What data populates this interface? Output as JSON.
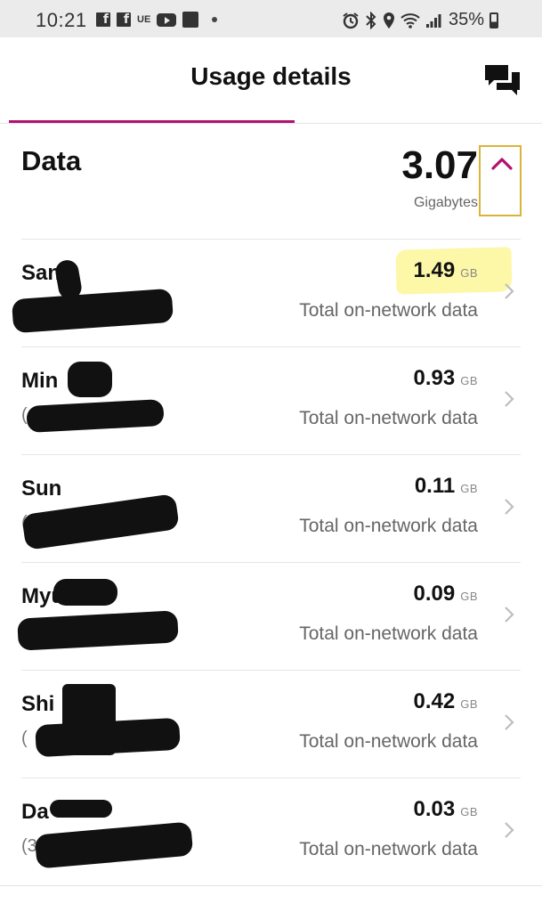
{
  "status_bar": {
    "time": "10:21",
    "ue_label": "UE",
    "battery": "35%",
    "icons": [
      "facebook-icon",
      "facebook-icon",
      "ue-icon",
      "youtube-icon",
      "bible-icon",
      "notification-dot-icon",
      "alarm-icon",
      "bluetooth-icon",
      "location-icon",
      "wifi-icon",
      "signal-icon",
      "battery-icon"
    ]
  },
  "header": {
    "title": "Usage details",
    "chat_icon": "chat-icon",
    "accent_color": "#b2116f"
  },
  "data_summary": {
    "heading": "Data",
    "total": "3.07",
    "unit": "Gigabytes",
    "toggle_icon": "chevron-up-icon"
  },
  "lines": [
    {
      "name": "San",
      "sub": "(",
      "amount": "1.49",
      "unit": "GB",
      "description": "Total on-network data"
    },
    {
      "name": "Min",
      "sub": "(",
      "amount": "0.93",
      "unit": "GB",
      "description": "Total on-network data"
    },
    {
      "name": "Sun",
      "sub": "(",
      "amount": "0.11",
      "unit": "GB",
      "description": "Total on-network data"
    },
    {
      "name": "Myu",
      "sub": "",
      "amount": "0.09",
      "unit": "GB",
      "description": "Total on-network data"
    },
    {
      "name": "Shi",
      "sub": "(",
      "amount": "0.42",
      "unit": "GB",
      "description": "Total on-network data"
    },
    {
      "name": "Da",
      "sub": "(3",
      "amount": "0.03",
      "unit": "GB",
      "description": "Total on-network data"
    }
  ]
}
